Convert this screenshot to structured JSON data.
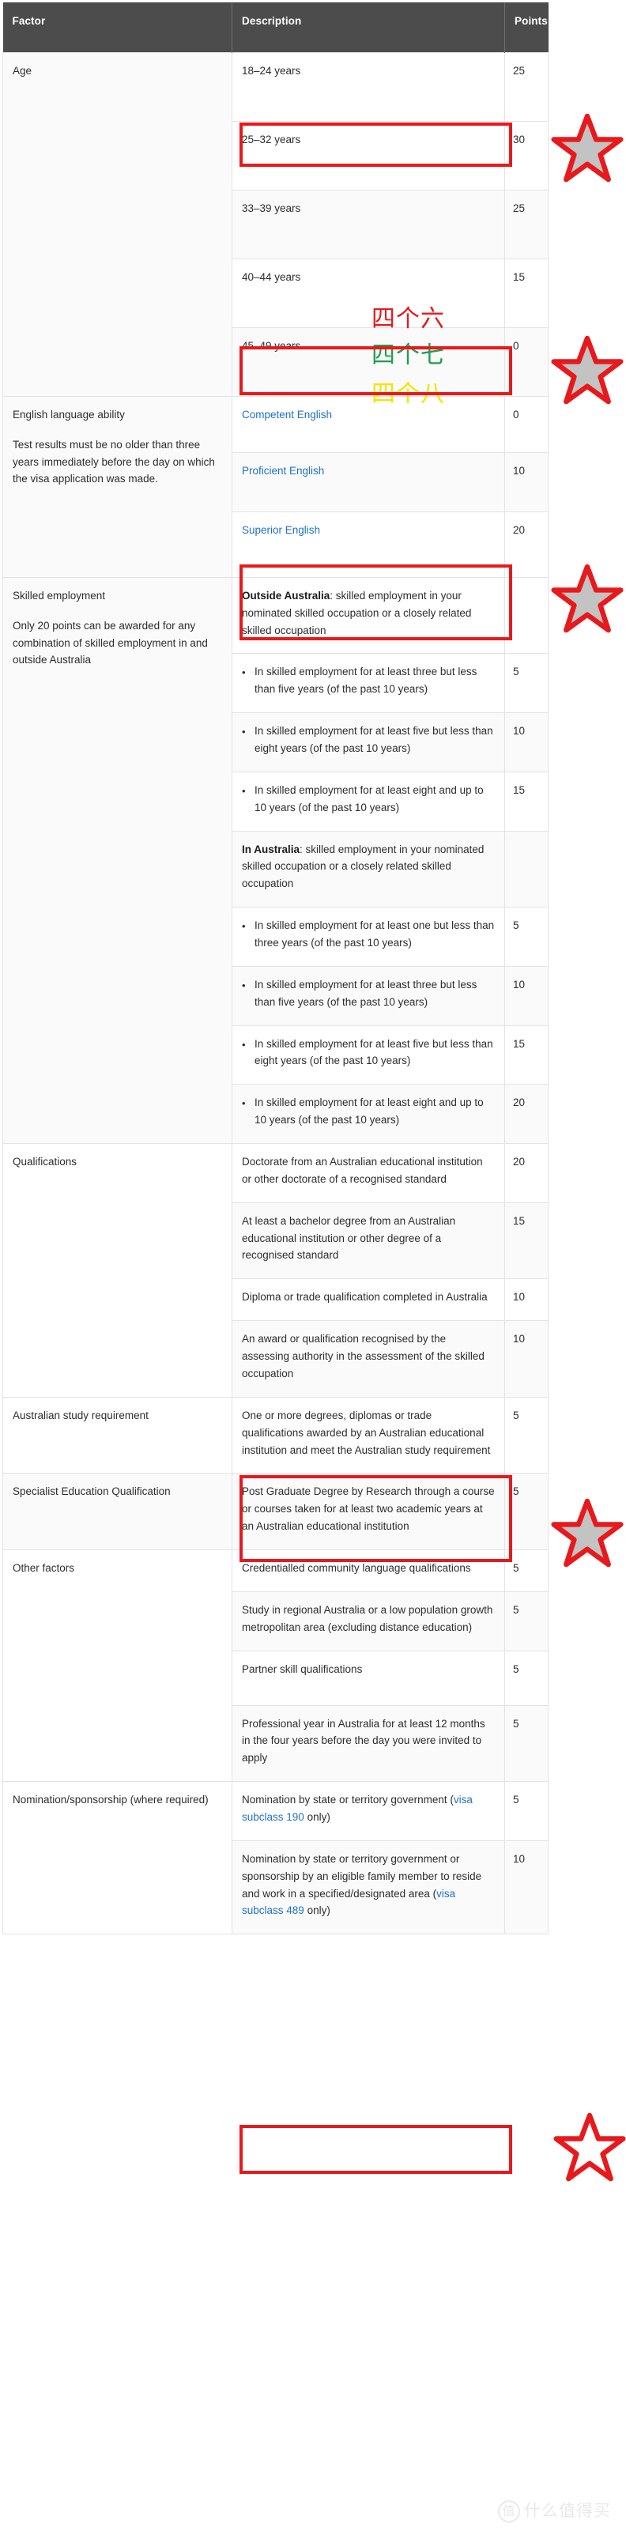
{
  "table": {
    "headers": [
      "Factor",
      "Description",
      "Points"
    ],
    "groups": [
      {
        "factor_lines": [
          "Age"
        ],
        "rows": [
          {
            "desc": "18–24 years",
            "points": "25"
          },
          {
            "desc": "25–32 years",
            "points": "30"
          },
          {
            "desc": "33–39 years",
            "points": "25"
          },
          {
            "desc": "40–44 years",
            "points": "15"
          },
          {
            "desc": "45–49 years",
            "points": "0"
          }
        ]
      },
      {
        "factor_lines": [
          "English language ability",
          "Test results must be no older than three years immediately before the day on which the visa application was made."
        ],
        "rows": [
          {
            "desc": "Competent English",
            "link": true,
            "points": "0"
          },
          {
            "desc": "Proficient English",
            "link": true,
            "points": "10"
          },
          {
            "desc": "Superior English",
            "link": true,
            "points": "20"
          }
        ]
      },
      {
        "factor_lines": [
          "Skilled employment",
          "Only 20 points can be awarded for any combination of skilled employment in and outside Australia"
        ],
        "rows": [
          {
            "label": "Outside Australia",
            "desc": ": skilled employment in your nominated skilled occupation or a closely related skilled occupation",
            "points": ""
          },
          {
            "bullet": true,
            "desc": "In skilled employment for at least three but less than five years (of the past 10 years)",
            "points": "5"
          },
          {
            "bullet": true,
            "desc": "In skilled employment for at least five but less than eight years (of the past 10 years)",
            "points": "10"
          },
          {
            "bullet": true,
            "desc": "In skilled employment for at least eight and up to 10 years (of the past 10 years)",
            "points": "15"
          },
          {
            "label": "In Australia",
            "desc": ": skilled employment in your nominated skilled occupation or a closely related skilled occupation",
            "points": ""
          },
          {
            "bullet": true,
            "desc": "In skilled employment for at least one but less than three years (of the past 10 years)",
            "points": "5"
          },
          {
            "bullet": true,
            "desc": "In skilled employment for at least three but less than five years (of the past 10 years)",
            "points": "10"
          },
          {
            "bullet": true,
            "desc": "In skilled employment for at least five but less than eight years (of the past 10 years)",
            "points": "15"
          },
          {
            "bullet": true,
            "desc": "In skilled employment for at least eight and up to 10 years (of the past 10 years)",
            "points": "20"
          }
        ]
      },
      {
        "factor_lines": [
          "Qualifications"
        ],
        "rows": [
          {
            "desc": "Doctorate from an Australian educational institution or other doctorate of a recognised standard",
            "points": "20"
          },
          {
            "desc": "At least a bachelor degree from an Australian educational institution or other degree of a recognised standard",
            "points": "15"
          },
          {
            "desc": "Diploma or trade qualification completed in Australia",
            "points": "10"
          },
          {
            "desc": "An award or qualification recognised by the assessing authority in the assessment of the skilled occupation",
            "points": "10"
          }
        ]
      },
      {
        "factor_lines": [
          "Australian study requirement"
        ],
        "rows": [
          {
            "desc": "One or more degrees, diplomas or trade qualifications awarded by an Australian educational institution and meet the Australian study requirement",
            "points": "5"
          }
        ]
      },
      {
        "factor_lines": [
          "Specialist Education Qualification"
        ],
        "rows": [
          {
            "desc": "Post Graduate Degree by Research through a course or courses taken for at least two academic years at an Australian educational institution",
            "points": "5"
          }
        ]
      },
      {
        "factor_lines": [
          "Other factors"
        ],
        "rows": [
          {
            "desc": "Credentialled community language qualifications",
            "points": "5"
          },
          {
            "desc": "Study in regional Australia or a low population growth metropolitan area (excluding distance education)",
            "points": "5"
          },
          {
            "desc": "Partner skill qualifications",
            "points": "5"
          },
          {
            "desc": "Professional year in Australia for at least 12 months in the four years before the day you were invited to apply",
            "points": "5"
          }
        ]
      },
      {
        "factor_lines": [
          "Nomination/sponsorship (where required)"
        ],
        "rows": [
          {
            "desc_pre": "Nomination by state or territory government (",
            "desc_link": "visa subclass 190",
            "desc_post": " only)",
            "points": "5"
          },
          {
            "desc_pre": "Nomination by state or territory government or sponsorship by an eligible family member to reside and work in a specified/designated area (",
            "desc_link": "visa subclass 489",
            "desc_post": " only)",
            "points": "10"
          }
        ]
      }
    ]
  },
  "annotations": {
    "chinese_notes": [
      {
        "text": "四个六",
        "color": "#e8191c"
      },
      {
        "text": "四个七",
        "color": "#1f9e4f"
      },
      {
        "text": "四个八",
        "color": "#f5e400"
      }
    ],
    "highlight_color": "#e8191c",
    "star_fill": "#c3c3c3",
    "star_stroke": "#e8191c",
    "highlighted_rows": [
      "25–32 years",
      "Proficient English",
      "In skilled employment for at least three but less than five years (of the past 10 years)",
      "At least a bachelor degree from an Australian educational institution or other degree of a recognised standard",
      "Partner skill qualifications"
    ]
  },
  "watermark": {
    "mark": "值",
    "text": "什么值得买"
  }
}
